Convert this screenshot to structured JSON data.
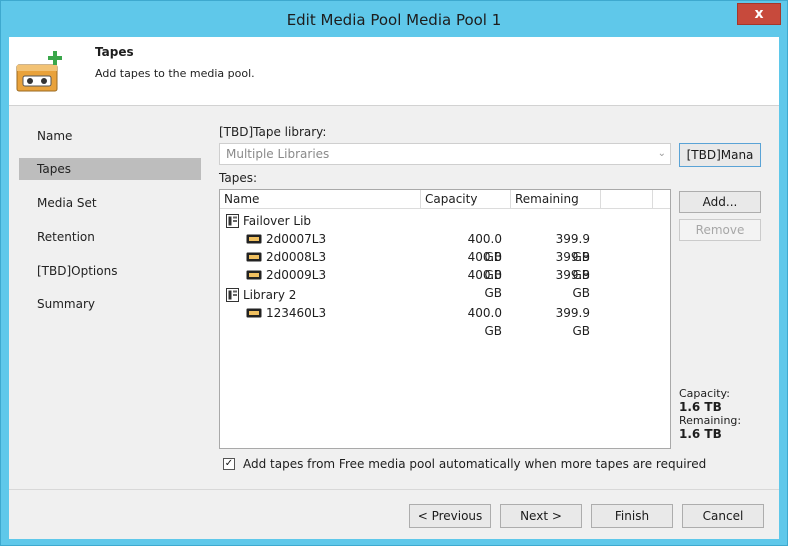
{
  "window": {
    "title": "Edit Media Pool Media Pool 1",
    "close_glyph": "x"
  },
  "header": {
    "title": "Tapes",
    "subtitle": "Add tapes to the media pool."
  },
  "nav": {
    "items": [
      {
        "label": "Name",
        "active": false
      },
      {
        "label": "Tapes",
        "active": true
      },
      {
        "label": "Media Set",
        "active": false
      },
      {
        "label": "Retention",
        "active": false
      },
      {
        "label": "[TBD]Options",
        "active": false
      },
      {
        "label": "Summary",
        "active": false
      }
    ]
  },
  "library": {
    "label": "[TBD]Tape library:",
    "value": "Multiple Libraries",
    "manage_button": "[TBD]Mana"
  },
  "tapes": {
    "label": "Tapes:",
    "columns": {
      "name": "Name",
      "capacity": "Capacity",
      "remaining": "Remaining"
    },
    "groups": [
      {
        "name": "Failover Lib",
        "items": [
          {
            "name": "2d0007L3",
            "capacity": "400.0 GB",
            "remaining": "399.9 GB"
          },
          {
            "name": "2d0008L3",
            "capacity": "400.0 GB",
            "remaining": "399.9 GB"
          },
          {
            "name": "2d0009L3",
            "capacity": "400.0 GB",
            "remaining": "399.9 GB"
          }
        ]
      },
      {
        "name": "Library 2",
        "items": [
          {
            "name": "123460L3",
            "capacity": "400.0 GB",
            "remaining": "399.9 GB"
          }
        ]
      }
    ]
  },
  "side_buttons": {
    "add": "Add...",
    "remove": "Remove"
  },
  "stats": {
    "capacity_label": "Capacity:",
    "capacity_value": "1.6 TB",
    "remaining_label": "Remaining:",
    "remaining_value": "1.6 TB"
  },
  "auto_add": {
    "checked": true,
    "label": "Add tapes from Free media pool automatically when more tapes are required"
  },
  "footer": {
    "previous": "< Previous",
    "next": "Next >",
    "finish": "Finish",
    "cancel": "Cancel"
  },
  "colors": {
    "titlebar": "#5fc8ea",
    "close": "#c74a3c",
    "nav_active": "#bdbdbd"
  }
}
